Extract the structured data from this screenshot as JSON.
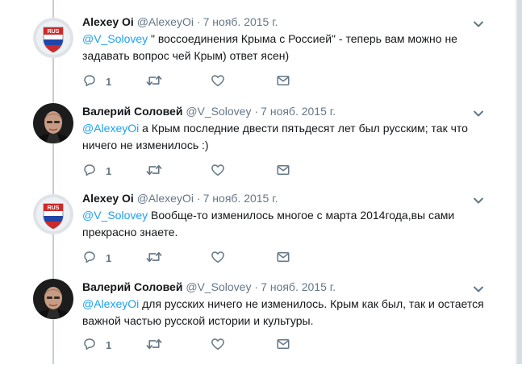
{
  "tweets": [
    {
      "name": "Alexey Oi",
      "handle": "@AlexeyOi",
      "separator": "·",
      "date": "7 нояб. 2015 г.",
      "mention": "@V_Solovey",
      "text": " \" воссоединения Крыма с Россией\" - теперь вам можно не задавать вопрос чей Крым) ответ ясен)",
      "reply_count": "1",
      "avatar": "rus-shield-avatar",
      "avatar_label": "RUS"
    },
    {
      "name": "Валерий Соловей",
      "handle": "@V_Solovey",
      "separator": "·",
      "date": "7 нояб. 2015 г.",
      "mention": "@AlexeyOi",
      "text": " а Крым последние двести пятьдесят лет был русским; так что ничего не изменилось :)",
      "reply_count": "1",
      "avatar": "man-portrait-avatar"
    },
    {
      "name": "Alexey Oi",
      "handle": "@AlexeyOi",
      "separator": "·",
      "date": "7 нояб. 2015 г.",
      "mention": "@V_Solovey",
      "text": " Вообще-то изменилось многое с марта 2014года,вы сами прекрасно знаете.",
      "reply_count": "1",
      "avatar": "rus-shield-avatar",
      "avatar_label": "RUS"
    },
    {
      "name": "Валерий Соловей",
      "handle": "@V_Solovey",
      "separator": "·",
      "date": "7 нояб. 2015 г.",
      "mention": "@AlexeyOi",
      "text": " для русских ничего не изменилось. Крым как был, так и остается важной частью русской истории и культуры.",
      "reply_count": "1",
      "avatar": "man-portrait-avatar"
    }
  ],
  "icons": {
    "reply": "reply-icon",
    "retweet": "retweet-icon",
    "like": "heart-icon",
    "dm": "envelope-icon",
    "more": "chevron-down-icon"
  },
  "colors": {
    "mention": "#1da1f2",
    "secondary_text": "#657786",
    "thread_line": "#c4cfd6",
    "avatar_shield_red": "#cc2a2a",
    "avatar_shield_blue": "#2344a8"
  }
}
